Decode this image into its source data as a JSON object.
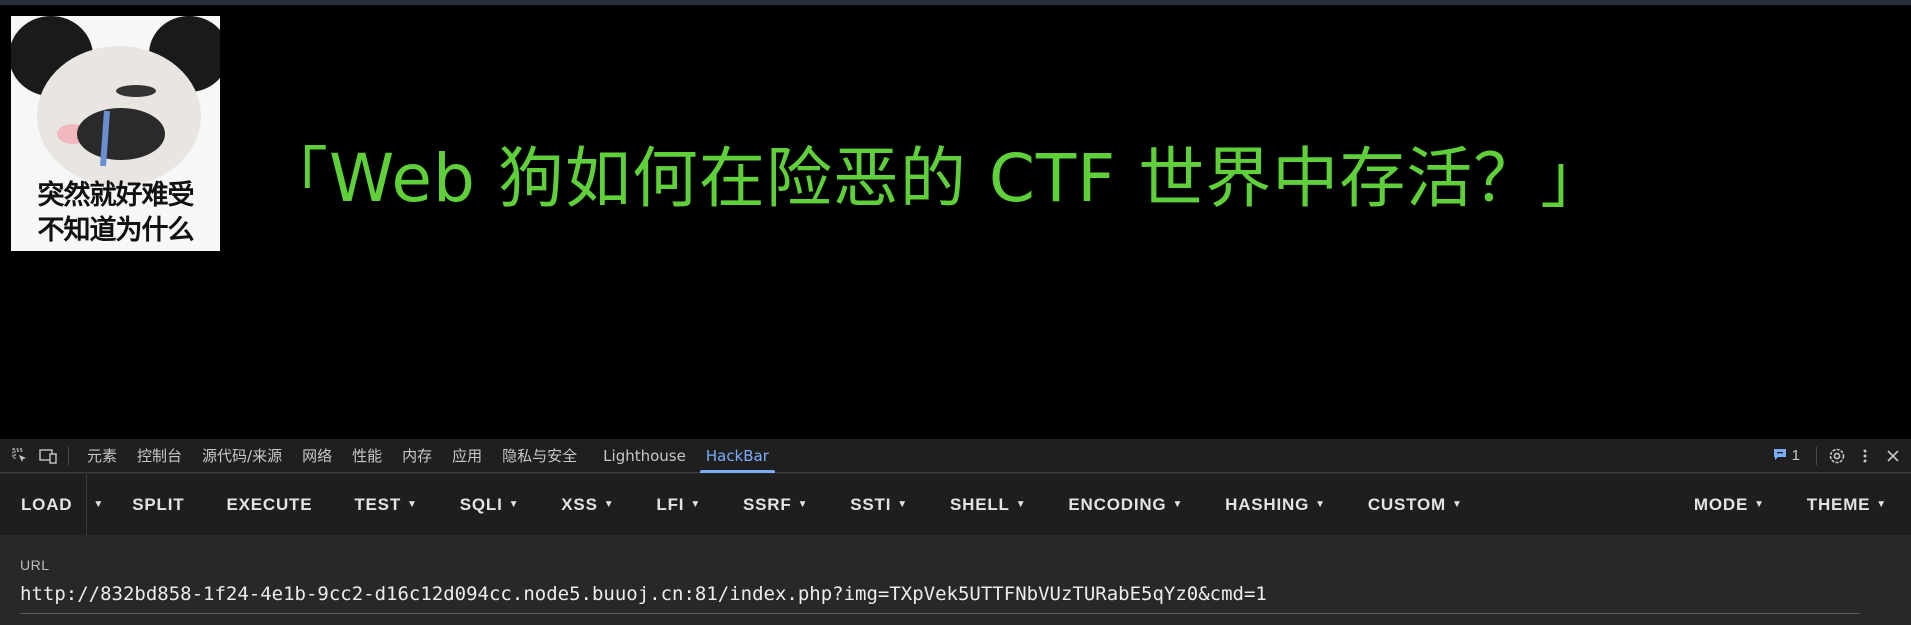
{
  "page": {
    "meme_caption_line1": "突然就好难受",
    "meme_caption_line2": "不知道为什么",
    "headline": "「Web 狗如何在险恶的 CTF 世界中存活？」"
  },
  "devtools": {
    "tabs": [
      "元素",
      "控制台",
      "源代码/来源",
      "网络",
      "性能",
      "内存",
      "应用",
      "隐私与安全",
      "Lighthouse",
      "HackBar"
    ],
    "active_tab": "HackBar",
    "issues_count": "1",
    "icons": [
      "inspect-element-icon",
      "device-toggle-icon",
      "issues-icon",
      "settings-gear-icon",
      "more-vertical-icon",
      "close-icon"
    ]
  },
  "hackbar": {
    "load": "LOAD",
    "split": "SPLIT",
    "execute": "EXECUTE",
    "menus": [
      "TEST",
      "SQLI",
      "XSS",
      "LFI",
      "SSRF",
      "SSTI",
      "SHELL",
      "ENCODING",
      "HASHING",
      "CUSTOM"
    ],
    "mode": "MODE",
    "theme": "THEME",
    "url_label": "URL",
    "url_value": "http://832bd858-1f24-4e1b-9cc2-d16c12d094cc.node5.buuoj.cn:81/index.php?img=TXpVek5UTTFNbVUzTURabE5qYz0&cmd=1"
  },
  "colors": {
    "headline": "#5fcf3a",
    "active_tab": "#7cacf8",
    "devtools_bg": "#282828"
  }
}
